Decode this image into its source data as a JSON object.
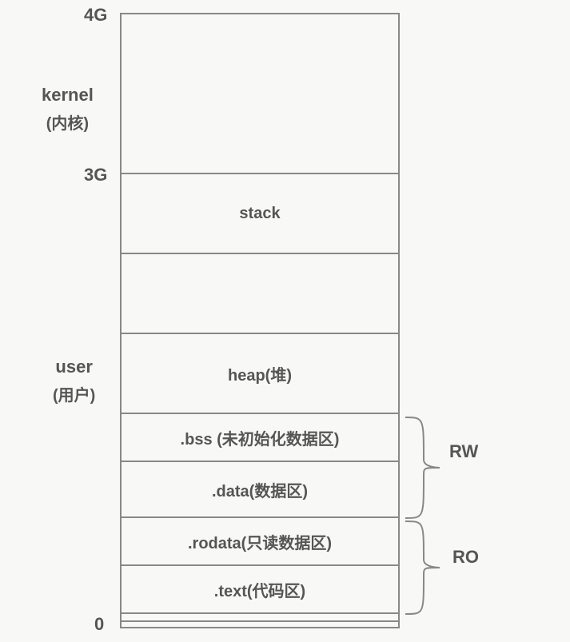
{
  "addresses": {
    "top": "4G",
    "kernel_boundary": "3G",
    "bottom": "0"
  },
  "spaces": {
    "kernel": {
      "title": "kernel",
      "subtitle": "(内核)"
    },
    "user": {
      "title": "user",
      "subtitle": "(用户)"
    }
  },
  "segments": {
    "stack": "stack",
    "heap": "heap(堆)",
    "bss": ".bss (未初始化数据区)",
    "data": ".data(数据区)",
    "rodata": ".rodata(只读数据区)",
    "text": ".text(代码区)"
  },
  "perms": {
    "rw": "RW",
    "ro": "RO"
  }
}
